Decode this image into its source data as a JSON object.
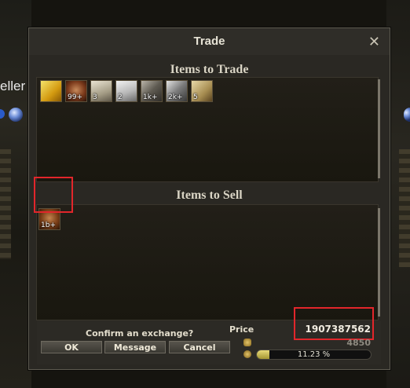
{
  "background": {
    "name_left": "eller",
    "name_right": "",
    "accent_blue": "#2a5bc9"
  },
  "window": {
    "title": "Trade",
    "close_icon": "close-icon"
  },
  "items_to_trade": {
    "title": "Items to Trade",
    "slots": [
      {
        "icon": "gold-bar-icon",
        "count": ""
      },
      {
        "icon": "bag-icon",
        "count": "99+"
      },
      {
        "icon": "scroll-icon",
        "count": "3"
      },
      {
        "icon": "plate-icon",
        "count": "2"
      },
      {
        "icon": "tool-icon",
        "count": "1k+"
      },
      {
        "icon": "wrench-icon",
        "count": "2k+"
      },
      {
        "icon": "map-icon",
        "count": "5"
      }
    ]
  },
  "items_to_sell": {
    "title": "Items to Sell",
    "slots": [
      {
        "icon": "pouch-icon",
        "count": "1b+"
      }
    ]
  },
  "footer": {
    "confirm_text": "Confirm an exchange?",
    "ok_label": "OK",
    "message_label": "Message",
    "cancel_label": "Cancel",
    "price_label": "Price",
    "price_value": "1907387562",
    "secondary_value": "4850",
    "progress_text": "11.23 %",
    "progress_percent": 11.23
  },
  "colors": {
    "highlight": "#e2262b",
    "progress_fill": "#e8da79"
  }
}
